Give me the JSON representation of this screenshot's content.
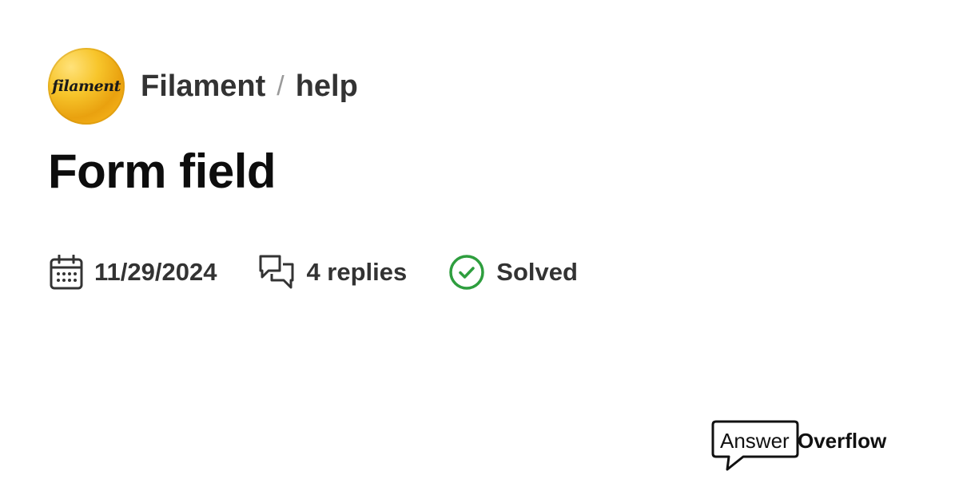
{
  "header": {
    "logo_text": "filament",
    "server_name": "Filament",
    "separator": "/",
    "channel_name": "help"
  },
  "thread": {
    "title": "Form field"
  },
  "meta": {
    "date": "11/29/2024",
    "replies": "4 replies",
    "status": "Solved",
    "status_color": "#2e9e3e"
  },
  "brand": {
    "answer": "Answer",
    "overflow": "Overflow"
  }
}
